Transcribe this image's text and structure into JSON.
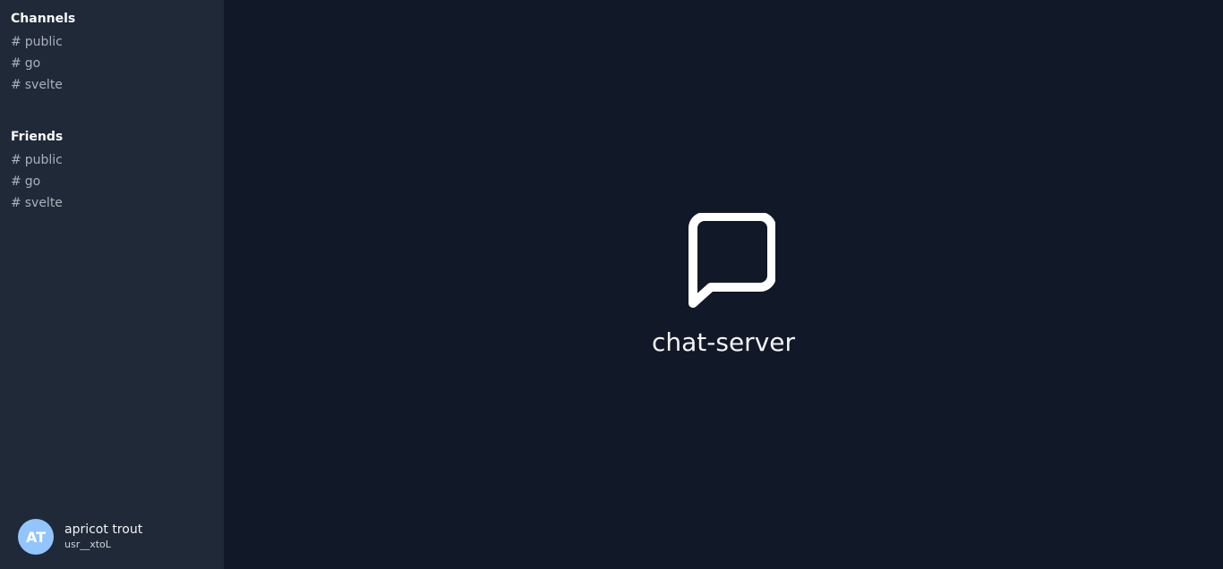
{
  "sidebar": {
    "sections": [
      {
        "title": "Channels",
        "items": [
          {
            "label": "public"
          },
          {
            "label": "go"
          },
          {
            "label": "svelte"
          }
        ]
      },
      {
        "title": "Friends",
        "items": [
          {
            "label": "public"
          },
          {
            "label": "go"
          },
          {
            "label": "svelte"
          }
        ]
      }
    ],
    "hash_symbol": "#",
    "user": {
      "initials": "AT",
      "name": "apricot trout",
      "id": "usr__xtoL"
    }
  },
  "main": {
    "icon": "chat-bubble-icon",
    "title": "chat-server"
  },
  "colors": {
    "sidebar_bg": "#1f2937",
    "main_bg": "#111827",
    "avatar_bg": "#93c5fd"
  }
}
